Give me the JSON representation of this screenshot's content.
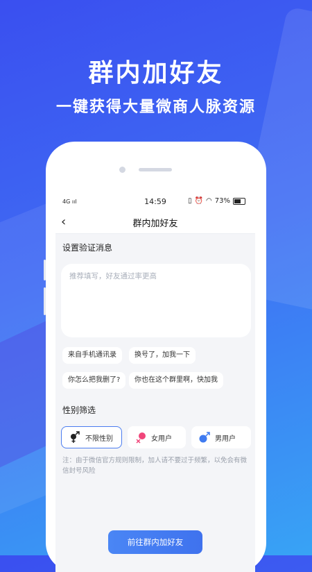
{
  "promo": {
    "title": "群内加好友",
    "subtitle": "一键获得大量微商人脉资源"
  },
  "status_bar": {
    "network": "4G",
    "time": "14:59",
    "battery": "73%"
  },
  "nav": {
    "title": "群内加好友"
  },
  "verify": {
    "section_title": "设置验证消息",
    "placeholder": "推荐填写，好友通过率更高",
    "templates": [
      "来自手机通讯录",
      "换号了，加我一下",
      "你怎么把我删了?",
      "你也在这个群里啊，快加我"
    ]
  },
  "gender": {
    "section_title": "性别筛选",
    "options": [
      {
        "label": "不限性别",
        "icon": "gender-both-icon",
        "selected": true
      },
      {
        "label": "女用户",
        "icon": "female-icon",
        "selected": false
      },
      {
        "label": "男用户",
        "icon": "male-icon",
        "selected": false
      }
    ]
  },
  "note": "注：由于微信官方规则限制，加人请不要过于频繁，以免会有微信封号风险",
  "cta_label": "前往群内加好友",
  "colors": {
    "accent": "#4a7cf0",
    "female": "#f0457a",
    "male": "#3f7bf0"
  }
}
